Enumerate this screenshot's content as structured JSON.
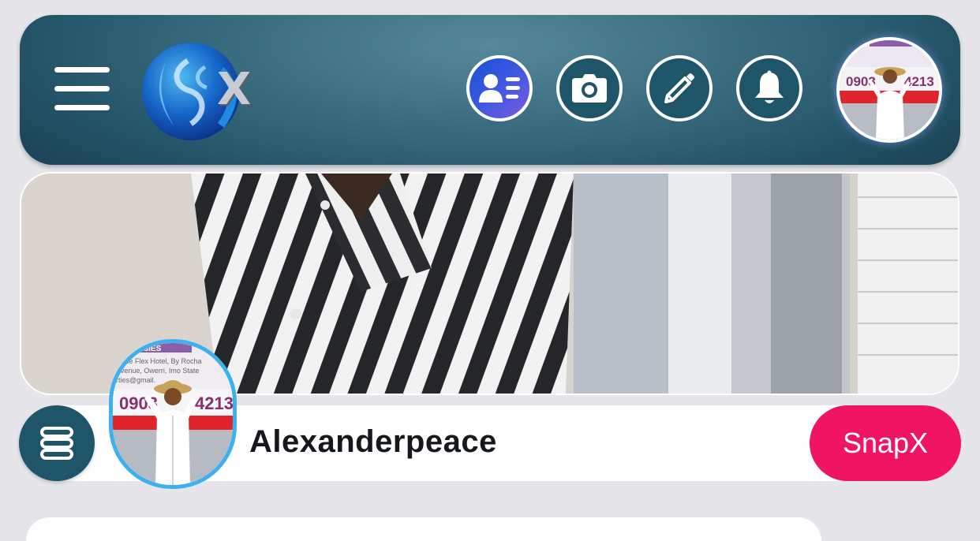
{
  "header": {
    "logo_letter": "X",
    "icons": {
      "menu": "hamburger-menu-icon",
      "profile_card": "profile-card-icon",
      "camera": "camera-icon",
      "edit": "pencil-icon",
      "notifications": "bell-icon"
    }
  },
  "avatar_sign": {
    "line1": "ssIES",
    "line2": "eside Flex Hotel, By Rocha",
    "line3": "Avenue, Owerri, Imo State",
    "line4": "rties@gmail.",
    "phone": "0903",
    "phone_end": "4213"
  },
  "profile": {
    "username": "Alexanderpeace",
    "action_button": "SnapX",
    "menu_icon": "stack-menu-icon"
  },
  "colors": {
    "header_dark": "#245468",
    "header_light": "#55889a",
    "accent_pink": "#f01462",
    "avatar_border": "#3db0ef",
    "button_teal": "#1f5568"
  }
}
